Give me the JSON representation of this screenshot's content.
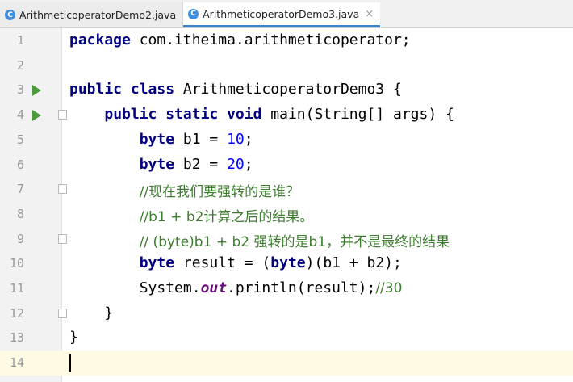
{
  "tabs": [
    {
      "label": "ArithmeticoperatorDemo2.java",
      "active": false
    },
    {
      "label": "ArithmeticoperatorDemo3.java",
      "active": true
    }
  ],
  "tab_icon_letter": "C",
  "tab_close_glyph": "×",
  "editor": {
    "lines": [
      {
        "n": "1",
        "tokens": [
          {
            "t": "package",
            "c": "kw"
          },
          {
            "t": " com.itheima.arithmeticoperator;",
            "c": ""
          }
        ]
      },
      {
        "n": "2",
        "tokens": []
      },
      {
        "n": "3",
        "run": true,
        "tokens": [
          {
            "t": "public class",
            "c": "kw"
          },
          {
            "t": " ArithmeticoperatorDemo3 {",
            "c": ""
          }
        ]
      },
      {
        "n": "4",
        "run": true,
        "fold": true,
        "tokens": [
          {
            "t": "    ",
            "c": ""
          },
          {
            "t": "public static void",
            "c": "kw"
          },
          {
            "t": " main(String[] args) {",
            "c": ""
          }
        ]
      },
      {
        "n": "5",
        "tokens": [
          {
            "t": "        ",
            "c": ""
          },
          {
            "t": "byte",
            "c": "kw"
          },
          {
            "t": " b1 = ",
            "c": ""
          },
          {
            "t": "10",
            "c": "num"
          },
          {
            "t": ";",
            "c": ""
          }
        ]
      },
      {
        "n": "6",
        "tokens": [
          {
            "t": "        ",
            "c": ""
          },
          {
            "t": "byte",
            "c": "kw"
          },
          {
            "t": " b2 = ",
            "c": ""
          },
          {
            "t": "20",
            "c": "num"
          },
          {
            "t": ";",
            "c": ""
          }
        ]
      },
      {
        "n": "7",
        "fold": true,
        "tokens": [
          {
            "t": "        ",
            "c": ""
          },
          {
            "t": "//现在我们要强转的是谁？",
            "c": "cm"
          }
        ]
      },
      {
        "n": "8",
        "tokens": [
          {
            "t": "        ",
            "c": ""
          },
          {
            "t": "//b1 + b2计算之后的结果。",
            "c": "cm"
          }
        ]
      },
      {
        "n": "9",
        "fold": true,
        "tokens": [
          {
            "t": "        ",
            "c": ""
          },
          {
            "t": "// (byte)b1 + b2 强转的是b1，并不是最终的结果",
            "c": "cm"
          }
        ]
      },
      {
        "n": "10",
        "tokens": [
          {
            "t": "        ",
            "c": ""
          },
          {
            "t": "byte",
            "c": "kw"
          },
          {
            "t": " result = (",
            "c": ""
          },
          {
            "t": "byte",
            "c": "kw"
          },
          {
            "t": ")(b1 + b2);",
            "c": ""
          }
        ]
      },
      {
        "n": "11",
        "tokens": [
          {
            "t": "        System.",
            "c": ""
          },
          {
            "t": "out",
            "c": "field"
          },
          {
            "t": ".println(result);",
            "c": ""
          },
          {
            "t": "//30",
            "c": "cm"
          }
        ]
      },
      {
        "n": "12",
        "fold": true,
        "tokens": [
          {
            "t": "    }",
            "c": ""
          }
        ]
      },
      {
        "n": "13",
        "tokens": [
          {
            "t": "}",
            "c": ""
          }
        ]
      },
      {
        "n": "14",
        "current": true,
        "cursor": true,
        "tokens": []
      }
    ]
  },
  "colors": {
    "keyword": "#000080",
    "number": "#0000ff",
    "comment": "#3c7d2e",
    "field": "#660e7a",
    "current_line": "#fffae3",
    "tab_accent": "#4083c9"
  }
}
